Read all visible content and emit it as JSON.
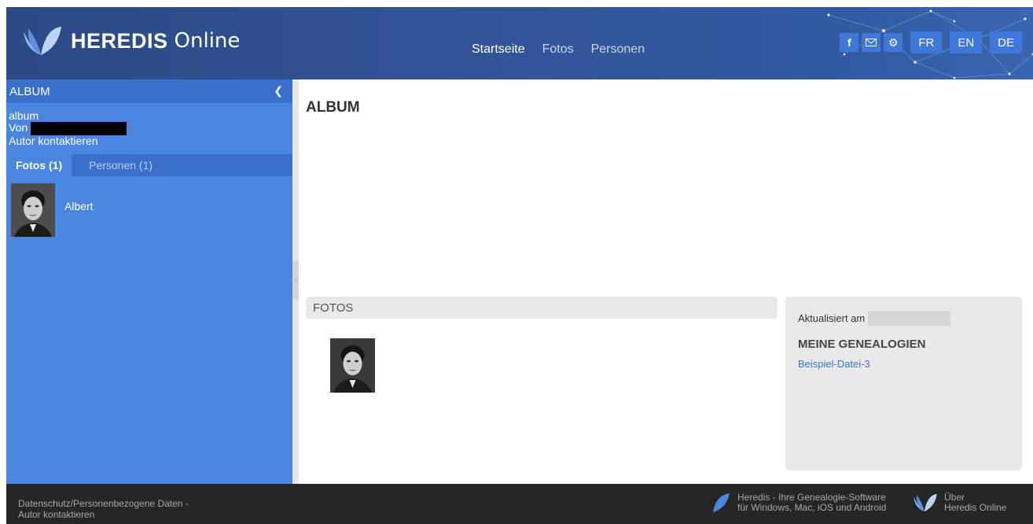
{
  "header": {
    "logo_word": "HEREDIS",
    "logo_sub": "Online",
    "nav": [
      {
        "label": "Startseite",
        "active": true
      },
      {
        "label": "Fotos",
        "active": false
      },
      {
        "label": "Personen",
        "active": false
      }
    ],
    "icons": [
      "facebook-icon",
      "mail-icon",
      "gear-icon"
    ],
    "languages": [
      "FR",
      "EN",
      "DE"
    ]
  },
  "sidebar": {
    "title": "ALBUM",
    "album_name": "album",
    "by_label": "Von",
    "contact": "Autor kontaktieren",
    "tabs": [
      {
        "label": "Fotos (1)",
        "active": true
      },
      {
        "label": "Personen (1)",
        "active": false
      }
    ],
    "items": [
      {
        "name": "Albert"
      }
    ]
  },
  "main": {
    "title": "ALBUM",
    "photos_header": "FOTOS"
  },
  "panel": {
    "updated_label": "Aktualisiert am",
    "section_title": "MEINE GENEALOGIEN",
    "link": "Beispiel-Datei-3"
  },
  "footer": {
    "privacy": "Datenschutz/Personenbezogene Daten -",
    "contact": "Autor kontaktieren",
    "heredis_line1": "Heredis - Ihre Genealogie-Software",
    "heredis_line2": "für Windows, Mac, iOS und Android",
    "about_line1": "Über",
    "about_line2": "Heredis Online"
  },
  "colors": {
    "header": "#2f5299",
    "sidebar": "#4a86e0",
    "sidebar_dark": "#3a6fcc",
    "button": "#3f78d8",
    "link": "#3a78c9",
    "footer": "#262626"
  }
}
